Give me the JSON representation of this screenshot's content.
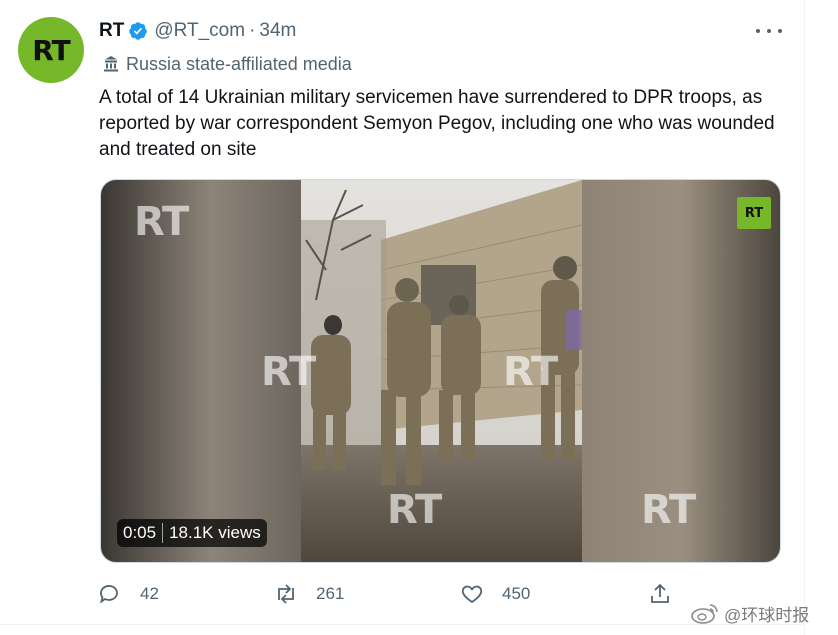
{
  "tweet": {
    "avatar_text": "RT",
    "display_name": "RT",
    "handle": "@RT_com",
    "separator": "·",
    "time": "34m",
    "label": "Russia state-affiliated media",
    "text": "A total of 14 Ukrainian military servicemen have surrendered to DPR troops, as reported by war correspondent Semyon Pegov, including one who was wounded and treated on site"
  },
  "media": {
    "watermark": "RT",
    "corner_logo": "RT",
    "duration": "0:05",
    "views": "18.1K views"
  },
  "actions": {
    "reply_count": "42",
    "retweet_count": "261",
    "like_count": "450"
  },
  "source_watermark": "@环球时报",
  "colors": {
    "brand_green": "#77b82a",
    "verified_blue": "#1d9bf0",
    "secondary_text": "#536471"
  },
  "icons": [
    "verified-badge-icon",
    "more-icon",
    "government-building-icon",
    "reply-icon",
    "retweet-icon",
    "like-icon",
    "share-icon",
    "weibo-icon"
  ]
}
